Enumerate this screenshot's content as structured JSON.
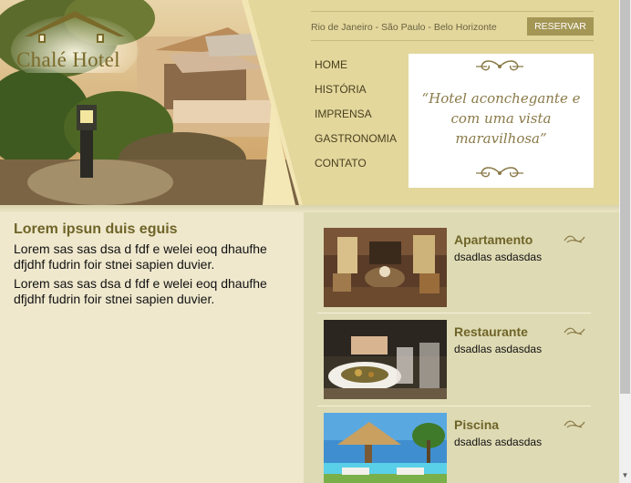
{
  "brand": {
    "name": "Chalé Hotel"
  },
  "header": {
    "cities": "Rio de Janeiro - São Paulo - Belo Horizonte",
    "reserve_label": "RESERVAR",
    "quote": "“Hotel aconchegante e com uma vista maravilhosa”"
  },
  "nav": {
    "items": [
      {
        "label": "HOME"
      },
      {
        "label": "HISTÓRIA"
      },
      {
        "label": "IMPRENSA"
      },
      {
        "label": "GASTRONOMIA"
      },
      {
        "label": "CONTATO"
      }
    ]
  },
  "main": {
    "heading": "Lorem ipsun duis eguis",
    "paragraphs": [
      "Lorem sas sas dsa d fdf e welei eoq dhaufhe dfjdhf fudrin foir stnei sapien duvier.",
      "Lorem sas sas dsa d fdf e welei eoq dhaufhe dfjdhf fudrin foir stnei sapien duvier."
    ]
  },
  "cards": [
    {
      "title": "Apartamento",
      "subtitle": "dsadlas asdasdas"
    },
    {
      "title": "Restaurante",
      "subtitle": "dsadlas asdasdas"
    },
    {
      "title": "Piscina",
      "subtitle": "dsadlas asdasdas"
    }
  ],
  "colors": {
    "header_bg": "#e3d79c",
    "accent": "#a49655",
    "title": "#6f6428",
    "panel": "#dedab3"
  },
  "icons": [
    "hotel-logo-icon",
    "ornament-icon",
    "swirl-icon",
    "scroll-down-arrow-icon"
  ]
}
